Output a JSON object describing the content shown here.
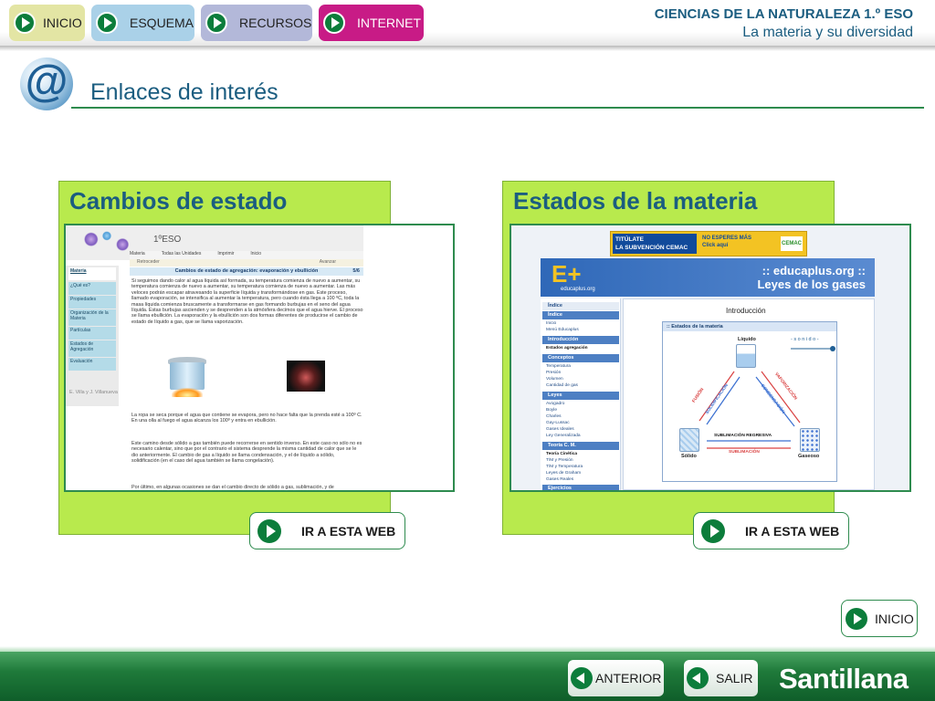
{
  "nav": {
    "inicio": "INICIO",
    "esquema": "ESQUEMA",
    "recursos": "RECURSOS",
    "internet": "INTERNET"
  },
  "course": {
    "title": "CIENCIAS DE LA NATURALEZA 1.º ESO",
    "subtitle": "La materia y su diversidad"
  },
  "page": {
    "icon": "at-sign-icon",
    "title": "Enlaces de interés"
  },
  "cards": [
    {
      "title": "Cambios de estado",
      "button": "IR A ESTA WEB",
      "preview": {
        "eso": "1ºESO",
        "menu": [
          "Materia",
          "Todas las Unidades",
          "Imprimir",
          "Inicio"
        ],
        "nav": [
          "Retroceder",
          "Avanzar"
        ],
        "breadcrumb": "Materia",
        "heading": "Cambios de estado de agregación: evaporación y ebullición",
        "page_no": "5/6",
        "sidebar": [
          "¿Qué es?",
          "Propiedades",
          "Organización de la Materia",
          "Partículas",
          "Estados de Agregación",
          "Evaluación"
        ],
        "para1": "Si seguimos dando calor al agua líquida así formada, su temperatura comienza de nuevo a aumentar, su temperatura comienza de nuevo a aumentar, su temperatura comienza de nuevo a aumentar. Las más veloces podrán escapar atravesando la superficie líquida y transformándose en gas. Este proceso, llamado evaporación, se intensifica al aumentar la temperatura, pero cuando ésta llega a 100 ºC, toda la masa líquida comienza bruscamente a transformarse en gas formando burbujas en el seno del agua líquida. Estas burbujas ascienden y se desprenden a la atmósfera decimos que el agua hierve. El proceso se llama ebullición. La evaporación y la ebullición son dos formas diferentes de producirse el cambio de estado de líquido a gas, que se llama vaporización.",
        "para2": "La ropa se seca porque el agua que contiene se evapora, pero no hace falta que la prenda esté a 100º C.\nEn una olla al fuego el agua alcanza los 100º y entra en ebullición.",
        "para3": "Este camino desde sólido a gas también puede recorrerse en sentido inverso. En este caso no sólo no es necesario calentar, sino que por el contrario el sistema desprende la misma cantidad de calor que se le dio anteriormente. El cambio de gas a líquido se llama condensación, y el de líquido a sólido, solidificación (en el caso del agua también se llama congelación).",
        "para4": "Por último, en algunas ocasiones se dan el cambio directo de sólido a gas, sublimación, y de",
        "credit": "E. Villa y J. Villanueva"
      }
    },
    {
      "title": "Estados de la materia",
      "button": "IR A ESTA WEB",
      "preview": {
        "banner_left": "TITÚLATE\nLA SUBVENCIÓN CEMAC",
        "banner_mid": "NO ESPERES MÁS\nClick aquí",
        "banner_right": "CEMAC",
        "logo": "E+",
        "logo_sub": "educaplus.org",
        "header": ":: educaplus.org ::\nLeyes de los gases",
        "sections": [
          {
            "label": "Índice",
            "items": [
              "Inicio",
              "Menú Educaplus"
            ]
          },
          {
            "label": "Introducción",
            "items": [
              "Estados agregación"
            ]
          },
          {
            "label": "Conceptos",
            "items": [
              "Temperatura",
              "Presión",
              "Volumen",
              "Cantidad de gas"
            ]
          },
          {
            "label": "Leyes",
            "items": [
              "Avogadro",
              "Boyle",
              "Charles",
              "Gay-Lussac",
              "Gases Ideales",
              "Ley Generalizada"
            ]
          },
          {
            "label": "Teoría C. M.",
            "items": [
              "Teoría Cinética",
              "T/M y Presión",
              "T/M y Temperatura",
              "Leyes de Graham",
              "Gases Reales"
            ]
          },
          {
            "label": "Ejercicios",
            "items": []
          }
        ],
        "intro": "Introducción",
        "box_title": ":: Estados de la materia",
        "liquid": "Líquido",
        "solid": "Sólido",
        "gas": "Gaseoso",
        "sonido": "- s o n i d o -",
        "fusion": "FUSIÓN",
        "solidificacion": "SOLIDIFICACIÓN",
        "vaporizacion": "VAPORIZACIÓN",
        "condensacion": "CONDENSACIÓN",
        "sub_regresiva": "SUBLIMACIÓN REGRESIVA",
        "sublimacion": "SUBLIMACIÓN"
      }
    }
  ],
  "bottom": {
    "inicio": "INICIO",
    "anterior": "ANTERIOR",
    "salir": "SALIR",
    "brand": "Santillana"
  },
  "colors": {
    "accent_green": "#2e8b4e",
    "card_green": "#b8ea4d",
    "title_blue": "#1b5d80",
    "internet_magenta": "#c81b86"
  }
}
